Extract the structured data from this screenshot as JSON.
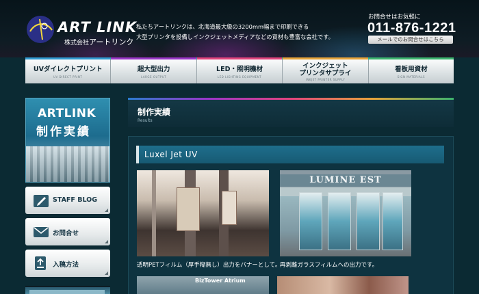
{
  "header": {
    "logo_main": "ART LINK",
    "logo_sub_prefix": "株式会社",
    "logo_sub_name": "アートリンク",
    "description_line1": "私たちアートリンクは、北海道最大級の3200mm幅まで印刷できる",
    "description_line2": "大型プリンタを設備しインクジェットメディアなどの資材も豊富な会社です。",
    "contact_label": "お問合せはお気軽に",
    "contact_phone": "011-876-1221",
    "contact_button": "メールでのお問合せはこちら"
  },
  "nav": {
    "items": [
      {
        "label": "UVダイレクトプリント",
        "sub": "UV DIRECT PRINT",
        "color": "#2f9ad0"
      },
      {
        "label": "超大型出力",
        "sub": "LARGE OUTPUT",
        "color": "#9b35c8"
      },
      {
        "label": "LED・照明機材",
        "sub": "LED LIGHTING EQUIPMENT",
        "color": "#e2447d"
      },
      {
        "label": "インクジェット\nプリンタサプライ",
        "sub": "INKJET PRINTER SUPPLY",
        "color": "#e7a43a"
      },
      {
        "label": "看板用資材",
        "sub": "SIGN MATERIALS",
        "color": "#3bb46e"
      }
    ]
  },
  "sidebar": {
    "banner_line1": "ARTLINK",
    "banner_line2": "制作実績",
    "buttons": [
      {
        "label": "STAFF BLOG",
        "icon": "pencil-icon"
      },
      {
        "label": "お問合せ",
        "icon": "envelope-icon"
      },
      {
        "label": "入稿方法",
        "icon": "upload-icon"
      }
    ]
  },
  "main": {
    "title": "制作実績",
    "subtitle": "Results",
    "section_title": "Luxel Jet UV",
    "photos": [
      {
        "caption": "透明PETフィルム（厚手糊無し）出力をバナーとして。"
      },
      {
        "caption": "再剥離ガラスフィルムへの出力です。",
        "sign_text": "LUMINE EST"
      },
      {
        "sign_text": "BizTower Atrium"
      },
      {}
    ]
  }
}
